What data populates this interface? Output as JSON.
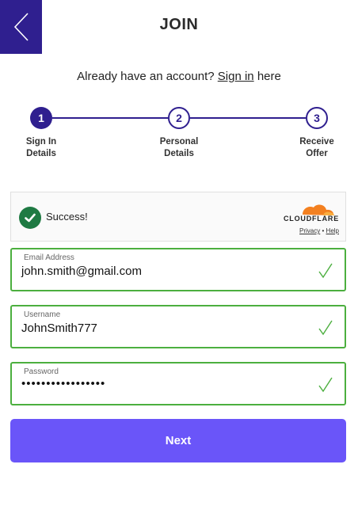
{
  "header": {
    "title": "JOIN",
    "back_icon": "chevron-left-icon"
  },
  "signin": {
    "prefix": "Already have an account?",
    "link_text": "Sign in",
    "suffix": "here"
  },
  "stepper": {
    "steps": [
      {
        "number": "1",
        "line1": "Sign In",
        "line2": "Details",
        "state": "active"
      },
      {
        "number": "2",
        "line1": "Personal",
        "line2": "Details",
        "state": "inactive"
      },
      {
        "number": "3",
        "line1": "Receive",
        "line2": "Offer",
        "state": "inactive"
      }
    ]
  },
  "captcha": {
    "status": "Success!",
    "brand": "CLOUDFLARE",
    "privacy_link": "Privacy",
    "separator": "•",
    "help_link": "Help"
  },
  "form": {
    "email": {
      "label": "Email Address",
      "value": "john.smith@gmail.com"
    },
    "username": {
      "label": "Username",
      "value": "JohnSmith777"
    },
    "password": {
      "label": "Password",
      "value": "•••••••••••••••••"
    }
  },
  "actions": {
    "next_label": "Next"
  },
  "colors": {
    "brand_dark": "#2f1f8f",
    "button": "#6a55f9",
    "valid": "#4caf3f",
    "success": "#1f7a43",
    "cloudflare_orange": "#f38020"
  }
}
